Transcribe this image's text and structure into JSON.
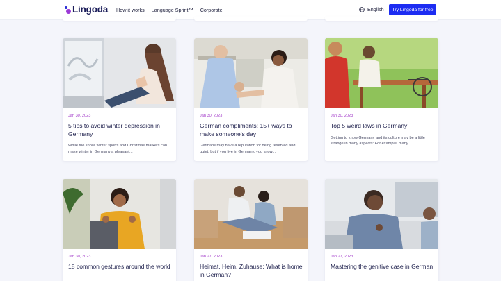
{
  "header": {
    "logo_text": "Lingoda",
    "nav": [
      "How it works",
      "Language Sprint™",
      "Corporate"
    ],
    "language": "English",
    "cta_label": "Try Lingoda for free"
  },
  "colors": {
    "accent": "#1c2cf2",
    "date": "#a239c9",
    "brand": "#1b1d5a"
  },
  "articles": [
    {
      "date": "Jan 30, 2023",
      "title": "5 tips to avoid winter depression in Germany",
      "excerpt": "While the  snow, winter sports and Christmas markets can make winter in Germany a pleasant..."
    },
    {
      "date": "Jan 30, 2023",
      "title": "German compliments: 15+ ways to make someone’s day",
      "excerpt": "Germans may have a reputation for being reserved and quiet, but if you live in Germany, you know..."
    },
    {
      "date": "Jan 30, 2023",
      "title": "Top 5 weird laws in Germany",
      "excerpt": "Getting to know Germany and its culture may be a little strange in many aspects: For example, many..."
    },
    {
      "date": "Jan 30, 2023",
      "title": "18 common gestures around the world",
      "excerpt": ""
    },
    {
      "date": "Jan 27, 2023",
      "title": "Heimat, Heim, Zuhause: What is home in German?",
      "excerpt": ""
    },
    {
      "date": "Jan 27, 2023",
      "title": "Mastering the genitive case in German",
      "excerpt": ""
    }
  ]
}
